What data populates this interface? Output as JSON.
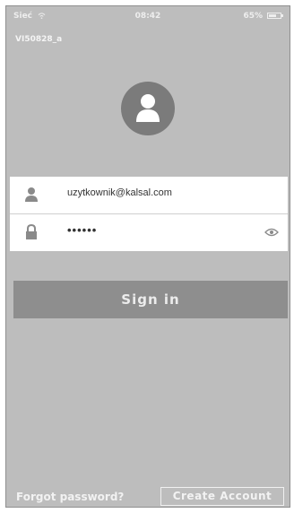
{
  "status_bar": {
    "carrier": "Sieć",
    "time": "08:42",
    "battery_percent_label": "65%",
    "battery_level": 0.65
  },
  "device_name": "VI50828_a",
  "avatar_icon": "user-avatar-icon",
  "login": {
    "username_icon": "user-icon",
    "username_value": "uzytkownik@kalsal.com",
    "password_icon": "lock-icon",
    "password_value": "••••••",
    "show_password_icon": "eye-icon"
  },
  "buttons": {
    "sign_in": "Sign in",
    "forgot_password": "Forgot password?",
    "create_account": "Create Account"
  },
  "colors": {
    "background": "#bdbdbd",
    "sign_in_button": "#8e8e8e",
    "avatar_circle": "#7b7b7b"
  }
}
